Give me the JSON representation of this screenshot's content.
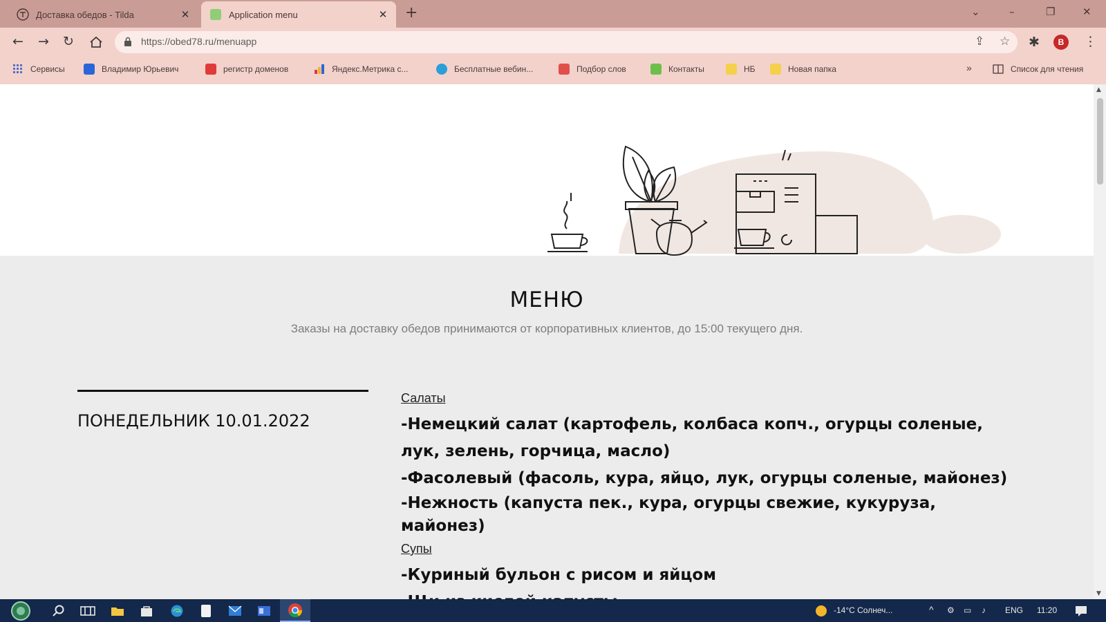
{
  "browser": {
    "tabs": [
      {
        "title": "Доставка обедов - Tilda",
        "active": false
      },
      {
        "title": "Application menu",
        "active": true
      }
    ],
    "new_tab": "+",
    "window_controls": {
      "dropdown": "⌄",
      "minimize": "–",
      "restore": "❐",
      "close": "✕"
    },
    "address": "https://obed78.ru/menuapp",
    "profile_initial": "В",
    "bookmarks": [
      {
        "label": "Сервисы",
        "icon_color": "#5470c6"
      },
      {
        "label": "Владимир Юрьевич",
        "icon_color": "#2a66d9"
      },
      {
        "label": "регистр доменов",
        "icon_color": "#e03a3a"
      },
      {
        "label": "Яндекс.Метрика с...",
        "icon_color": "#f2b233"
      },
      {
        "label": "Бесплатные вебин...",
        "icon_color": "#2a9fd9"
      },
      {
        "label": "Подбор слов",
        "icon_color": "#e0504a"
      },
      {
        "label": "Контакты",
        "icon_color": "#6cc04a"
      },
      {
        "label": "НБ",
        "icon_color": "#f5d04a"
      },
      {
        "label": "Новая папка",
        "icon_color": "#f5d04a"
      }
    ],
    "bookmarks_more": "»",
    "reading_list": "Список для чтения"
  },
  "page": {
    "title": "МЕНЮ",
    "subtitle": "Заказы на доставку обедов принимаются от корпоративных клиентов, до 15:00 текущего дня.",
    "day": "ПОНЕДЕЛЬНИК 10.01.2022",
    "categories": [
      {
        "name": "Салаты",
        "items": [
          "-Немецкий салат (картофель, колбаса копч., огурцы соленые, лук, зелень, горчица, масло)",
          "-Фасолевый (фасоль, кура, яйцо, лук, огурцы соленые, майонез)",
          "-Нежность (капуста пек., кура, огурцы свежие, кукуруза, майонез)"
        ]
      },
      {
        "name": "Супы",
        "items": [
          "-Куриный бульон с рисом и яйцом",
          "-Щи из кислой капусты"
        ]
      }
    ]
  },
  "taskbar": {
    "weather": "-14°C Солнеч...",
    "language": "ENG",
    "clock": "11:20"
  },
  "colors": {
    "tabbar_bg": "#c99d96",
    "toolbar_bg": "#f3d2cc",
    "menu_section_bg": "#ececec",
    "taskbar_bg": "#13284a"
  }
}
